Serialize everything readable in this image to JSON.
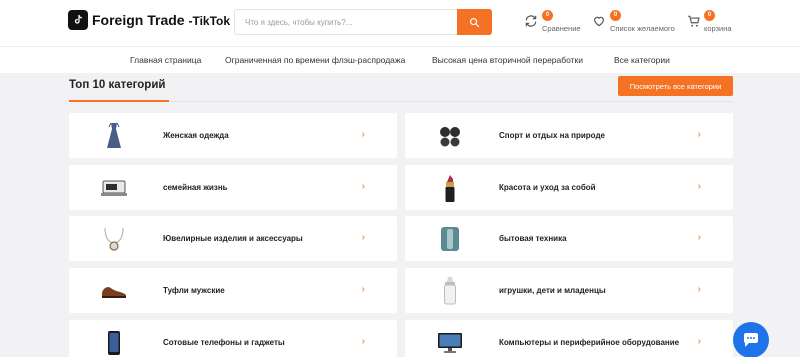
{
  "header": {
    "logo": {
      "brand": "Foreign Trade",
      "sub": "-TikTok"
    },
    "search": {
      "placeholder": "Что я здесь, чтобы купить?...",
      "value": ""
    },
    "compare": {
      "count": "0",
      "label": "Сравнение"
    },
    "wishlist": {
      "count": "0",
      "label": "Список желаемого"
    },
    "cart": {
      "count": "0",
      "label": "корзина"
    }
  },
  "nav": {
    "items": [
      {
        "label": "Главная страница"
      },
      {
        "label": "Ограниченная по времени флэш-распродажа"
      },
      {
        "label": "Высокая цена вторичной переработки"
      },
      {
        "label": "Все категории"
      }
    ]
  },
  "section": {
    "title": "Топ 10 категорий",
    "view_all": "Посмотреть все категории"
  },
  "categories": [
    {
      "label": "Женская одежда",
      "icon": "dress-icon"
    },
    {
      "label": "Спорт и отдых на природе",
      "icon": "sports-icon"
    },
    {
      "label": "семейная жизнь",
      "icon": "home-appliance-icon"
    },
    {
      "label": "Красота и уход за собой",
      "icon": "lipstick-icon"
    },
    {
      "label": "Ювелирные изделия и аксессуары",
      "icon": "necklace-icon"
    },
    {
      "label": "бытовая техника",
      "icon": "household-appliance-icon"
    },
    {
      "label": "Туфли мужские",
      "icon": "shoe-icon"
    },
    {
      "label": "игрушки, дети и младенцы",
      "icon": "baby-bottle-icon"
    },
    {
      "label": "Сотовые телефоны и гаджеты",
      "icon": "phone-icon"
    },
    {
      "label": "Компьютеры и периферийное оборудование",
      "icon": "monitor-icon"
    }
  ],
  "colors": {
    "accent": "#f57224",
    "chat": "#1e73e8",
    "background": "#f2f2f4"
  }
}
